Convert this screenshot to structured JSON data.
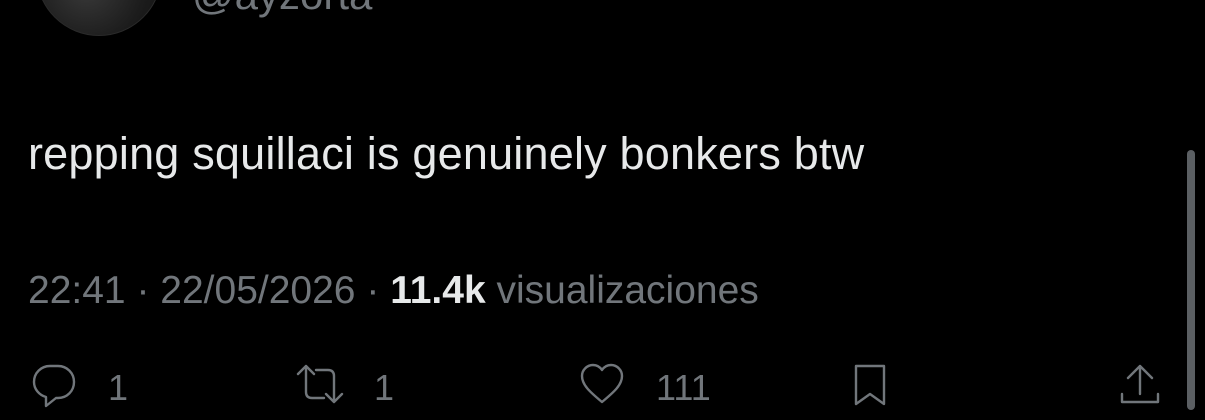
{
  "author": {
    "handle": "@ayzorta"
  },
  "tweet": {
    "text": "repping squillaci is genuinely bonkers btw",
    "time": "22:41",
    "date": "22/05/2026",
    "separator": "·",
    "views_count": "11.4k",
    "views_label": "visualizaciones"
  },
  "actions": {
    "reply_count": "1",
    "retweet_count": "1",
    "like_count": "111"
  },
  "icons": {
    "reply": "reply-icon",
    "retweet": "retweet-icon",
    "like": "heart-icon",
    "bookmark": "bookmark-icon",
    "share": "share-icon"
  },
  "colors": {
    "background": "#000000",
    "text_primary": "#e7e9ea",
    "text_secondary": "#71767b"
  }
}
